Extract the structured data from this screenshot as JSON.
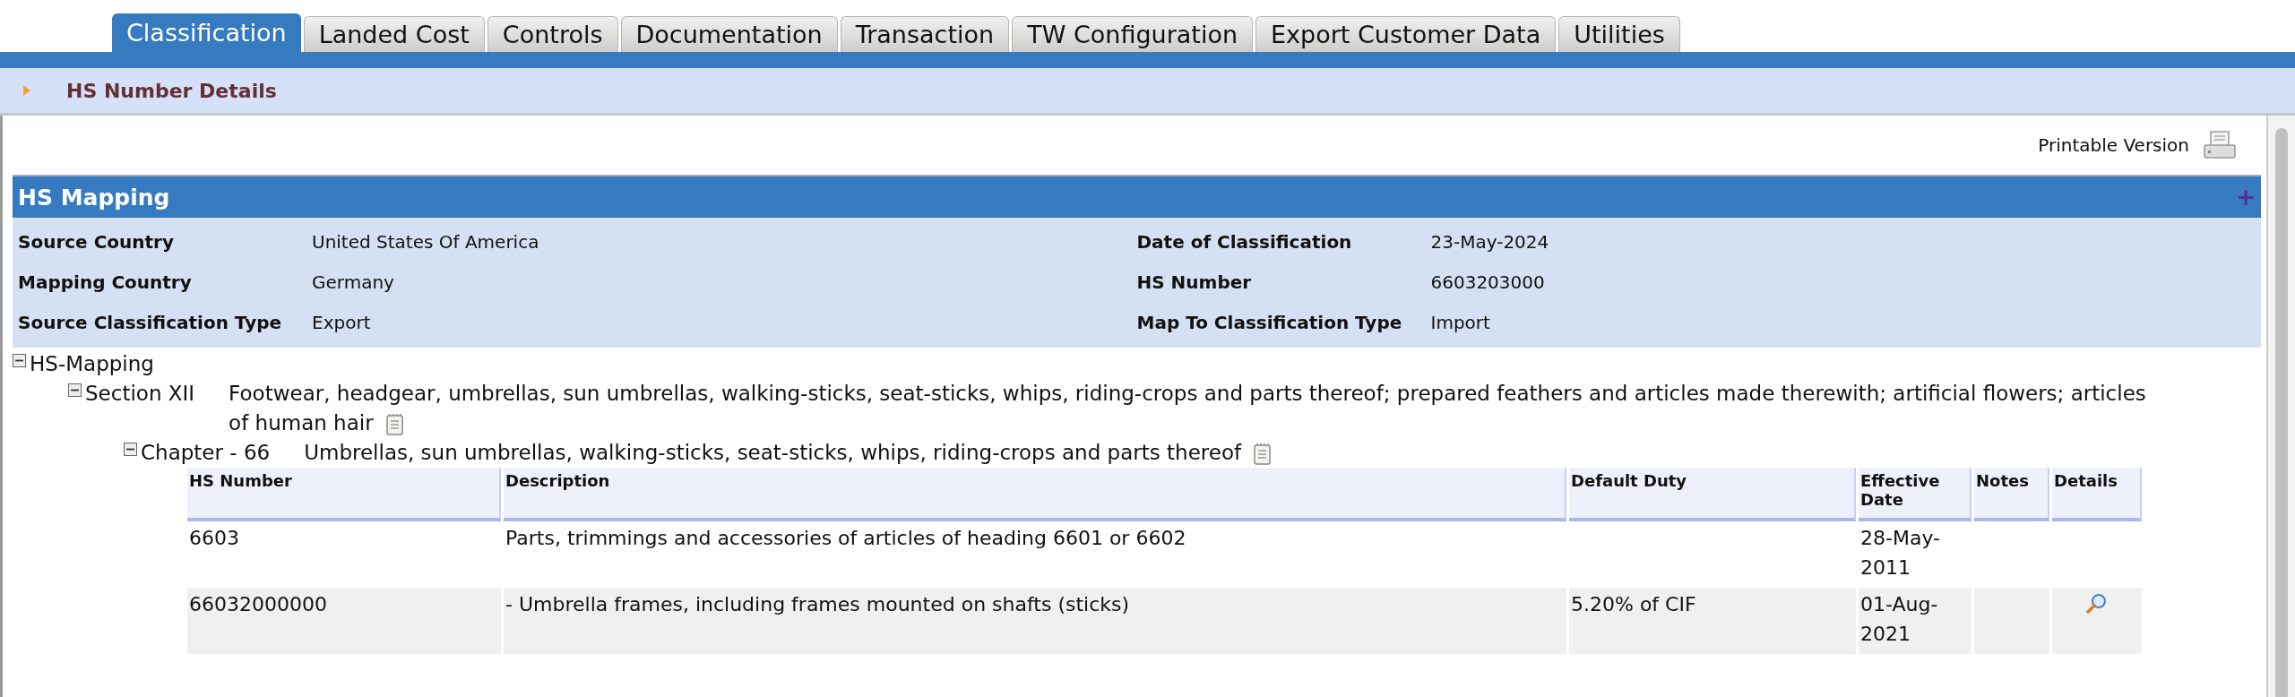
{
  "tabs": [
    {
      "label": "Classification",
      "selected": true
    },
    {
      "label": "Landed Cost",
      "selected": false
    },
    {
      "label": "Controls",
      "selected": false
    },
    {
      "label": "Documentation",
      "selected": false
    },
    {
      "label": "Transaction",
      "selected": false
    },
    {
      "label": "TW Configuration",
      "selected": false
    },
    {
      "label": "Export Customer Data",
      "selected": false
    },
    {
      "label": "Utilities",
      "selected": false
    }
  ],
  "subheader": {
    "title": "HS Number Details"
  },
  "printable": {
    "label": "Printable Version"
  },
  "panel": {
    "title": "HS Mapping",
    "expand_symbol": "+",
    "fields_left": [
      {
        "label": "Source Country",
        "value": "United States Of America"
      },
      {
        "label": "Mapping Country",
        "value": "Germany"
      },
      {
        "label": "Source Classification Type",
        "value": "Export"
      }
    ],
    "fields_right": [
      {
        "label": "Date of Classification",
        "value": "23-May-2024"
      },
      {
        "label": "HS Number",
        "value": "6603203000"
      },
      {
        "label": "Map To Classification Type",
        "value": "Import"
      }
    ]
  },
  "tree": {
    "label": "HS-Mapping",
    "expanded": true,
    "children": [
      {
        "label": "Section XII",
        "description": "Footwear, headgear, umbrellas, sun umbrellas, walking-sticks, seat-sticks, whips, riding-crops and parts thereof; prepared feathers and articles made therewith; artificial flowers; articles of human hair",
        "expanded": true,
        "children": [
          {
            "label": "Chapter - 66",
            "description": "Umbrellas, sun umbrellas, walking-sticks, seat-sticks, whips, riding-crops and parts thereof",
            "expanded": true
          }
        ]
      }
    ]
  },
  "table": {
    "columns": [
      "HS Number",
      "Description",
      "Default Duty",
      "Effective Date",
      "Notes",
      "Details"
    ],
    "rows": [
      {
        "hs_number": "6603",
        "description": "Parts, trimmings and accessories of articles of heading 6601 or 6602",
        "effective_date": "28-May-2011"
      },
      {
        "hs_number": "66032000000",
        "description": "- Umbrella frames, including frames mounted on shafts (sticks)",
        "default_duty": "5.20% of CIF",
        "effective_date": "01-Aug-2021",
        "has_details": true
      }
    ]
  }
}
